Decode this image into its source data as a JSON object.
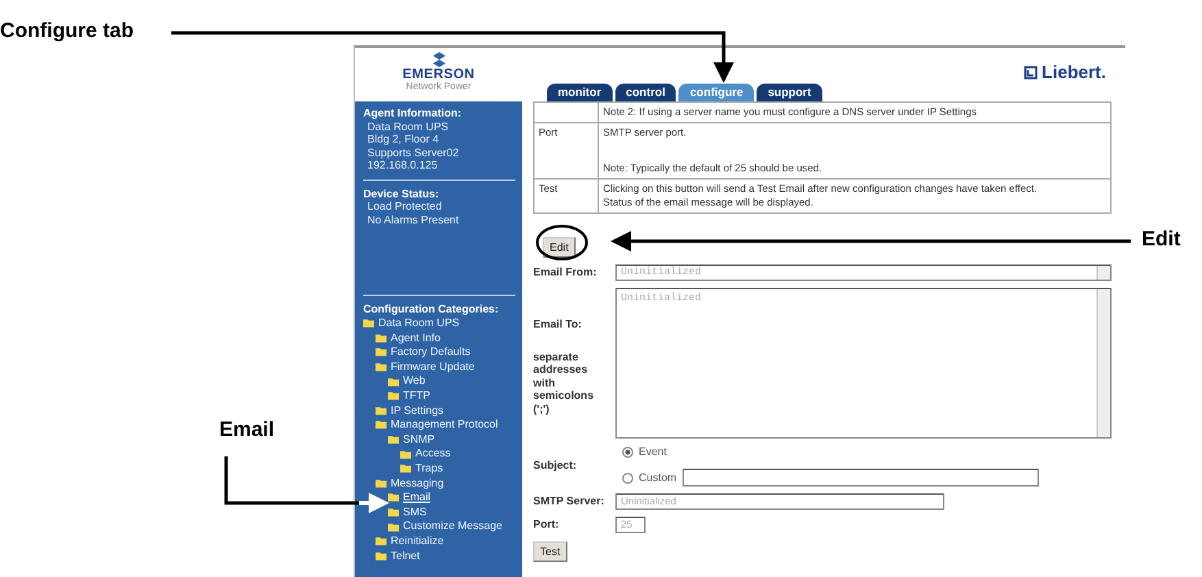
{
  "callouts": [
    {
      "label": "Configure tab"
    },
    {
      "label": "Edit"
    },
    {
      "label": "Email"
    }
  ],
  "header": {
    "brand": "EMERSON",
    "brand_sub": "Network Power",
    "partner": "Liebert."
  },
  "tabs": [
    {
      "label": "monitor",
      "selected": false
    },
    {
      "label": "control",
      "selected": false
    },
    {
      "label": "configure",
      "selected": true
    },
    {
      "label": "support",
      "selected": false
    }
  ],
  "agent_info": {
    "title": "Agent Information:",
    "lines": [
      "Data Room UPS",
      "Bldg 2, Floor 4",
      "Supports Server02",
      "192.168.0.125"
    ]
  },
  "device_status": {
    "title": "Device Status:",
    "lines": [
      "Load Protected",
      "No Alarms Present"
    ]
  },
  "categories": {
    "title": "Configuration Categories:",
    "tree": [
      {
        "label": "Data Room UPS",
        "selected": false,
        "children": [
          {
            "label": "Agent Info",
            "selected": false
          },
          {
            "label": "Factory Defaults",
            "selected": false
          },
          {
            "label": "Firmware Update",
            "selected": false,
            "children": [
              {
                "label": "Web",
                "selected": false
              },
              {
                "label": "TFTP",
                "selected": false
              }
            ]
          },
          {
            "label": "IP Settings",
            "selected": false
          },
          {
            "label": "Management Protocol",
            "selected": false,
            "children": [
              {
                "label": "SNMP",
                "selected": false,
                "children": [
                  {
                    "label": "Access",
                    "selected": false
                  },
                  {
                    "label": "Traps",
                    "selected": false
                  }
                ]
              }
            ]
          },
          {
            "label": "Messaging",
            "selected": false,
            "children": [
              {
                "label": "Email",
                "selected": true
              },
              {
                "label": "SMS",
                "selected": false
              },
              {
                "label": "Customize Message",
                "selected": false
              }
            ]
          },
          {
            "label": "Reinitialize",
            "selected": false
          },
          {
            "label": "Telnet",
            "selected": false
          }
        ]
      }
    ]
  },
  "help_table": [
    {
      "lines": [
        "Note 2: If using a server name you must configure a DNS server under IP Settings"
      ]
    },
    {
      "name": "Port",
      "lines": [
        "SMTP server port.",
        "Note: Typically the default of 25 should be used."
      ]
    },
    {
      "name": "Test",
      "lines": [
        "Clicking on this button will send a Test Email after new configuration changes have taken effect.",
        "Status of the email message will be displayed."
      ]
    }
  ],
  "edit_button": "Edit",
  "form": {
    "email_from": {
      "label": "Email From:",
      "value": "Uninitialized"
    },
    "email_to": {
      "label": "Email To:",
      "hint": "separate addresses with semicolons (';')",
      "value": "Uninitialized"
    },
    "subject": {
      "label": "Subject:",
      "options": [
        {
          "label": "Event",
          "selected": true
        },
        {
          "label": "Custom",
          "selected": false
        }
      ]
    },
    "smtp_server": {
      "label": "SMTP Server:",
      "value": "Uninitialized"
    },
    "port": {
      "label": "Port:",
      "value": "25"
    },
    "test_button": "Test"
  }
}
